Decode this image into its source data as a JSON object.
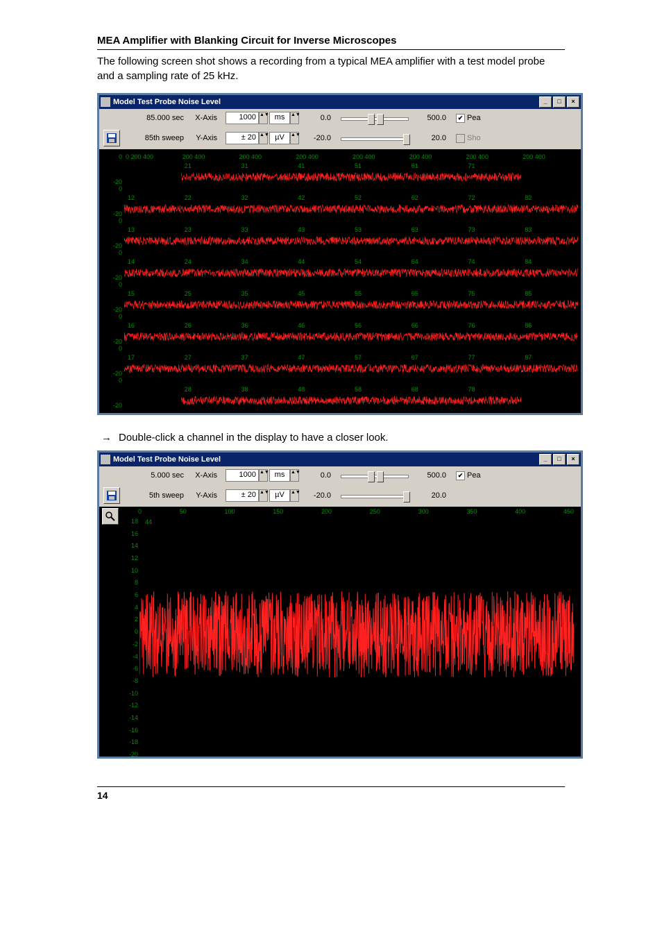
{
  "header": "MEA Amplifier with Blanking Circuit for Inverse Microscopes",
  "intro": "The following screen shot shows a recording from a typical MEA amplifier with a test model probe and a sampling rate of 25 kHz.",
  "instruction_arrow": "→",
  "instruction_text": "Double-click a channel in the display to have a closer look.",
  "page_number": "14",
  "win1": {
    "title": "Model Test Probe Noise Level",
    "row1": {
      "time": "85.000 sec",
      "xaxis_label": "X-Axis",
      "xaxis_val": "1000",
      "xaxis_unit": "ms",
      "slider_left": "0.0",
      "slider_right": "500.0",
      "cb_label": "Pea",
      "cb_checked": true
    },
    "row2": {
      "sweep": "85th sweep",
      "yaxis_label": "Y-Axis",
      "yaxis_val": "± 20",
      "yaxis_unit": "µV",
      "slider_left": "-20.0",
      "slider_right": "20.0",
      "cb_label": "Sho",
      "cb_checked": false
    },
    "xticks": "0   200  400    200  400    200  400    200  400    200  400    200  400    200  400    200  40",
    "yscale": [
      "0",
      "-20"
    ],
    "grid_rows": [
      [
        "",
        "21",
        "31",
        "41",
        "51",
        "61",
        "71",
        ""
      ],
      [
        "12",
        "22",
        "32",
        "42",
        "52",
        "62",
        "72",
        "82"
      ],
      [
        "13",
        "23",
        "33",
        "43",
        "53",
        "63",
        "73",
        "83"
      ],
      [
        "14",
        "24",
        "34",
        "44",
        "54",
        "64",
        "74",
        "84"
      ],
      [
        "15",
        "25",
        "35",
        "45",
        "55",
        "65",
        "75",
        "85"
      ],
      [
        "16",
        "26",
        "36",
        "46",
        "56",
        "66",
        "76",
        "86"
      ],
      [
        "17",
        "27",
        "37",
        "47",
        "57",
        "67",
        "77",
        "87"
      ],
      [
        "",
        "28",
        "38",
        "48",
        "58",
        "68",
        "78",
        ""
      ]
    ]
  },
  "win2": {
    "title": "Model Test Probe Noise Level",
    "row1": {
      "time": "5.000 sec",
      "xaxis_label": "X-Axis",
      "xaxis_val": "1000",
      "xaxis_unit": "ms",
      "slider_left": "0.0",
      "slider_right": "500.0",
      "cb_label": "Pea",
      "cb_checked": true
    },
    "row2": {
      "sweep": "5th sweep",
      "yaxis_label": "Y-Axis",
      "yaxis_val": "± 20",
      "yaxis_unit": "µV",
      "slider_left": "-20.0",
      "slider_right": "20.0",
      "cb_label": "",
      "cb_checked": false
    },
    "channel": "44",
    "xticks": [
      "0",
      "50",
      "100",
      "150",
      "200",
      "250",
      "300",
      "350",
      "400",
      "450"
    ],
    "yticks": [
      "18",
      "16",
      "14",
      "12",
      "10",
      "8",
      "6",
      "4",
      "2",
      "0",
      "-2",
      "-4",
      "-6",
      "-8",
      "-10",
      "-12",
      "-14",
      "-16",
      "-18",
      "-20"
    ]
  },
  "chart_data": [
    {
      "type": "line",
      "title": "Model Test Probe Noise Level — 60-channel grid",
      "xlabel": "ms",
      "ylabel": "µV",
      "xlim": [
        0,
        500
      ],
      "ylim": [
        -20,
        20
      ],
      "note": "8×8 channel layout (corners 11,18,81,88 blank). Each cell shows a noise trace roughly ±8 µV amplitude.",
      "channels": [
        "21",
        "31",
        "41",
        "51",
        "61",
        "71",
        "12",
        "22",
        "32",
        "42",
        "52",
        "62",
        "72",
        "82",
        "13",
        "23",
        "33",
        "43",
        "53",
        "63",
        "73",
        "83",
        "14",
        "24",
        "34",
        "44",
        "54",
        "64",
        "74",
        "84",
        "15",
        "25",
        "35",
        "45",
        "55",
        "65",
        "75",
        "85",
        "16",
        "26",
        "36",
        "46",
        "56",
        "66",
        "76",
        "86",
        "17",
        "27",
        "37",
        "47",
        "57",
        "67",
        "77",
        "87",
        "28",
        "38",
        "48",
        "58",
        "68",
        "78"
      ]
    },
    {
      "type": "line",
      "title": "Model Test Probe Noise Level — Channel 44 zoom",
      "xlabel": "ms",
      "ylabel": "µV",
      "xlim": [
        0,
        500
      ],
      "ylim": [
        -20,
        20
      ],
      "note": "Continuous noise recording, amplitude roughly ±8 µV, randomly distributed across the full 500 ms window.",
      "series": [
        {
          "name": "44",
          "values_description": "dense random noise, mean≈0 µV, peaks≈±8 µV"
        }
      ]
    }
  ]
}
